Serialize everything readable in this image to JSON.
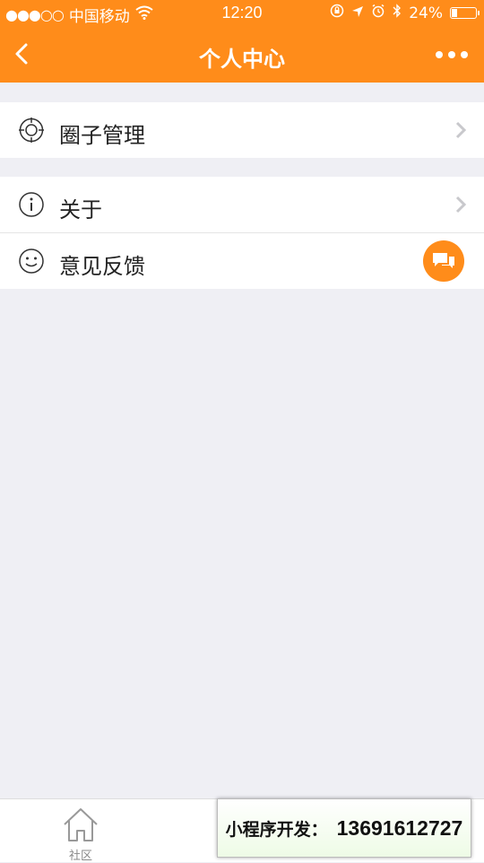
{
  "status_bar": {
    "signal": "●●●○○",
    "carrier": "中国移动",
    "time": "12:20",
    "battery_percent": "24%",
    "battery_level": 0.24
  },
  "nav": {
    "title": "个人中心"
  },
  "groups": [
    {
      "items": [
        {
          "label": "圈子管理",
          "icon": "target-icon"
        }
      ]
    },
    {
      "items": [
        {
          "label": "关于",
          "icon": "info-icon"
        },
        {
          "label": "意见反馈",
          "icon": "smiley-icon"
        }
      ]
    }
  ],
  "tabbar": {
    "tabs": [
      {
        "label": "社区",
        "icon": "home-icon"
      }
    ]
  },
  "banner": {
    "label": "小程序开发：",
    "phone": "13691612727"
  },
  "colors": {
    "accent": "#ff8c1a",
    "background": "#efeff4"
  }
}
